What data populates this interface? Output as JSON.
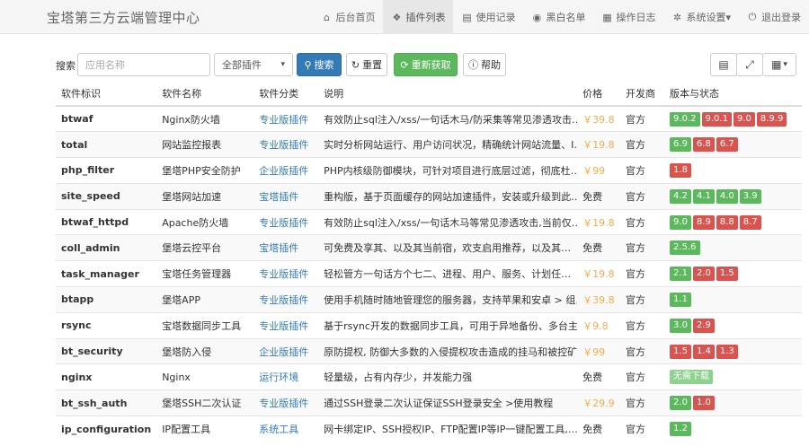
{
  "brand": "宝塔第三方云端管理中心",
  "nav": [
    {
      "icon": "home-icon",
      "glyph": "⌂",
      "label": "后台首页"
    },
    {
      "icon": "plugins-icon",
      "glyph": "❖",
      "label": "插件列表",
      "active": true
    },
    {
      "icon": "log-icon",
      "glyph": "▤",
      "label": "使用记录"
    },
    {
      "icon": "globe-icon",
      "glyph": "◉",
      "label": "黑白名单"
    },
    {
      "icon": "calendar-icon",
      "glyph": "▦",
      "label": "操作日志"
    },
    {
      "icon": "gear-icon",
      "glyph": "✲",
      "label": "系统设置▾"
    },
    {
      "icon": "power-icon",
      "glyph": "⏻",
      "label": "退出登录"
    }
  ],
  "toolbar": {
    "search_label": "搜索",
    "search_placeholder": "应用名称",
    "category_selected": "全部插件",
    "search_btn": "搜索",
    "reset_btn": "重置",
    "refresh_btn": "重新获取",
    "help_btn": "帮助"
  },
  "columns": [
    "软件标识",
    "软件名称",
    "软件分类",
    "说明",
    "价格",
    "开发商",
    "版本与状态"
  ],
  "rows": [
    {
      "id": "btwaf",
      "name": "Nginx防火墙",
      "type": "专业版插件",
      "desc": "有效防止sql注入/xss/一句话木马/防采集等常见渗透攻击…",
      "price": "￥39.8",
      "dev": "官方",
      "versions": [
        {
          "v": "9.0.2",
          "c": "green"
        },
        {
          "v": "9.0.1",
          "c": "red"
        },
        {
          "v": "9.0",
          "c": "red"
        },
        {
          "v": "8.9.9",
          "c": "red"
        }
      ]
    },
    {
      "id": "total",
      "name": "网站监控报表",
      "type": "专业版插件",
      "desc": "实时分析网站运行、用户访问状况，精确统计网站流量、I…",
      "price": "￥19.8",
      "dev": "官方",
      "versions": [
        {
          "v": "6.9",
          "c": "green"
        },
        {
          "v": "6.8",
          "c": "red"
        },
        {
          "v": "6.7",
          "c": "red"
        }
      ]
    },
    {
      "id": "php_filter",
      "name": "堡塔PHP安全防护",
      "type": "企业版插件",
      "desc": "PHP内核级防御模块，可针对项目进行底层过滤，彻底杜…",
      "price": "￥99",
      "dev": "官方",
      "versions": [
        {
          "v": "1.8",
          "c": "red"
        }
      ]
    },
    {
      "id": "site_speed",
      "name": "堡塔网站加速",
      "type": "宝塔插件",
      "desc": "重构版，基于页面缓存的网站加速插件，安装或升级到此…",
      "price": "免费",
      "dev": "官方",
      "versions": [
        {
          "v": "4.2",
          "c": "green"
        },
        {
          "v": "4.1",
          "c": "green"
        },
        {
          "v": "4.0",
          "c": "green"
        },
        {
          "v": "3.9",
          "c": "green"
        }
      ]
    },
    {
      "id": "btwaf_httpd",
      "name": "Apache防火墙",
      "type": "专业版插件",
      "desc": "有效防止sql注入/xss/一句话木马等常见渗透攻击,当前仅…",
      "price": "￥19.8",
      "dev": "官方",
      "versions": [
        {
          "v": "9.0",
          "c": "green"
        },
        {
          "v": "8.9",
          "c": "red"
        },
        {
          "v": "8.8",
          "c": "red"
        },
        {
          "v": "8.7",
          "c": "red"
        }
      ]
    },
    {
      "id": "coll_admin",
      "name": "堡塔云控平台",
      "type": "宝塔插件",
      "desc": "可免费及享其、以及其当前宿，欢支启用推荐，以及其…",
      "price": "免费",
      "dev": "官方",
      "versions": [
        {
          "v": "2.5.6",
          "c": "green"
        }
      ]
    },
    {
      "id": "task_manager",
      "name": "宝塔任务管理器",
      "type": "专业版插件",
      "desc": "轻松管方一句话方个七二、进程、用户、服务、计划任…",
      "price": "￥19.8",
      "dev": "官方",
      "versions": [
        {
          "v": "2.1",
          "c": "green"
        },
        {
          "v": "2.0",
          "c": "red"
        },
        {
          "v": "1.5",
          "c": "red"
        }
      ]
    },
    {
      "id": "btapp",
      "name": "堡塔APP",
      "type": "专业版插件",
      "desc": "使用手机随时随地管理您的服务器，支持苹果和安卓 > 组…",
      "price": "￥39.8",
      "dev": "官方",
      "versions": [
        {
          "v": "1.1",
          "c": "green"
        }
      ]
    },
    {
      "id": "rsync",
      "name": "宝塔数据同步工具",
      "type": "专业版插件",
      "desc": "基于rsync开发的数据同步工具，可用于异地备份、多台主…",
      "price": "￥9.8",
      "dev": "官方",
      "versions": [
        {
          "v": "3.0",
          "c": "green"
        },
        {
          "v": "2.9",
          "c": "red"
        }
      ]
    },
    {
      "id": "bt_security",
      "name": "堡塔防入侵",
      "type": "企业版插件",
      "desc": "原防提权, 防御大多数的入侵提权攻击造成的挂马和被控矿…",
      "price": "￥99",
      "dev": "官方",
      "versions": [
        {
          "v": "1.5",
          "c": "red"
        },
        {
          "v": "1.4",
          "c": "red"
        },
        {
          "v": "1.3",
          "c": "red"
        }
      ]
    },
    {
      "id": "nginx",
      "name": "Nginx",
      "type": "运行环境",
      "desc": "轻量级，占有内存少，并发能力强",
      "price": "免费",
      "dev": "官方",
      "versions": [
        {
          "v": "无需下载",
          "c": "lightgreen"
        }
      ]
    },
    {
      "id": "bt_ssh_auth",
      "name": "堡塔SSH二次认证",
      "type": "专业版插件",
      "desc": "通过SSH登录二次认证保证SSH登录安全 >使用教程",
      "price": "￥29.9",
      "dev": "官方",
      "versions": [
        {
          "v": "2.0",
          "c": "green"
        },
        {
          "v": "1.0",
          "c": "red"
        }
      ]
    },
    {
      "id": "ip_configuration",
      "name": "IP配置工具",
      "type": "系统工具",
      "desc": "网卡绑定IP、SSH授权IP、FTP配置IP等IP一键配置工具,…",
      "price": "免费",
      "dev": "官方",
      "versions": [
        {
          "v": "1.2",
          "c": "green"
        }
      ]
    }
  ]
}
